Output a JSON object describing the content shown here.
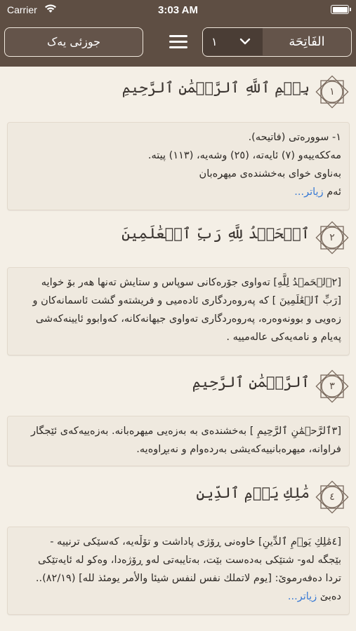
{
  "status_bar": {
    "carrier": "Carrier",
    "time": "3:03 AM"
  },
  "header": {
    "juz_label": "جوزئی یەک",
    "surah_number": "١",
    "surah_name": "الفَاتِحَة"
  },
  "ayahs": [
    {
      "number": "١",
      "arabic": "بِسۡمِ ٱللَّهِ ٱلرَّحۡمَٰنِ ٱلرَّحِيمِ",
      "tafsir_lines": [
        "١- سوورەتی (فاتیحە).",
        "مەککەییەو (٧) ئایەتە، (٢٥) وشەیە، (١١٣) پیتە.",
        "بەناوی خوای بەخشندەی میهرەبان"
      ],
      "last_line_prefix": "ئەم",
      "more_label": "زیاتر..."
    },
    {
      "number": "٢",
      "arabic": "ٱلۡحَمۡدُ لِلَّهِ رَبِّ ٱلۡعَٰلَمِينَ",
      "tafsir_lines": [
        "[٢ٱلۡحَمۡدُ لِلَّهِ] تەواوی جۆرەکانی سوپاس و ستایش تەنها هەر بۆ خوایە",
        "[رَبِّ ٱلۡعَٰلَمِينَ ]  کە پەروەردگاری ئادەمیی و فریشتەو گشت ئاسمانەکان و",
        "زەویی و بوونەوەرە، پەروەردگاری تەواوی جیهانەکانە، کەوابوو ئایینەکەشی",
        "پەیام و نامەیەکی عالەمییە ."
      ]
    },
    {
      "number": "٣",
      "arabic": "ٱلرَّحۡمَٰنِ ٱلرَّحِيمِ",
      "tafsir_lines": [
        "[٣ٱلرَّحۡمَٰنِ ٱلرَّحِيمِ ] بەخشندەی بە بەزەیی میهرەبانە. بەزەییەکەی ئێجگار",
        "فراوانە، میهرەبانییەکەیشی بەردەوام و نەبڕاوەیە."
      ]
    },
    {
      "number": "٤",
      "arabic": "مَٰلِكِ يَوۡمِ ٱلدِّينِ",
      "tafsir_lines": [
        "[٤مَٰلِكِ يَوۡمِ ٱلدِّينِ] خاوەنی ڕۆژی پاداشت و تۆڵەیە، کەسێکی ترنییە -",
        "بێجگە لەو- شتێکی بەدەست بێت، بەتایبەتی لەو ڕۆژەدا، وەکو لە ئایەتێکی",
        "تردا دەفەرموێ: [يوم لاتملك نفس لنفس شيئا والأمر يومئذ لله] (٨٢/١٩).."
      ],
      "last_line_prefix": "دەبێ",
      "more_label": "زیاتر..."
    }
  ]
}
